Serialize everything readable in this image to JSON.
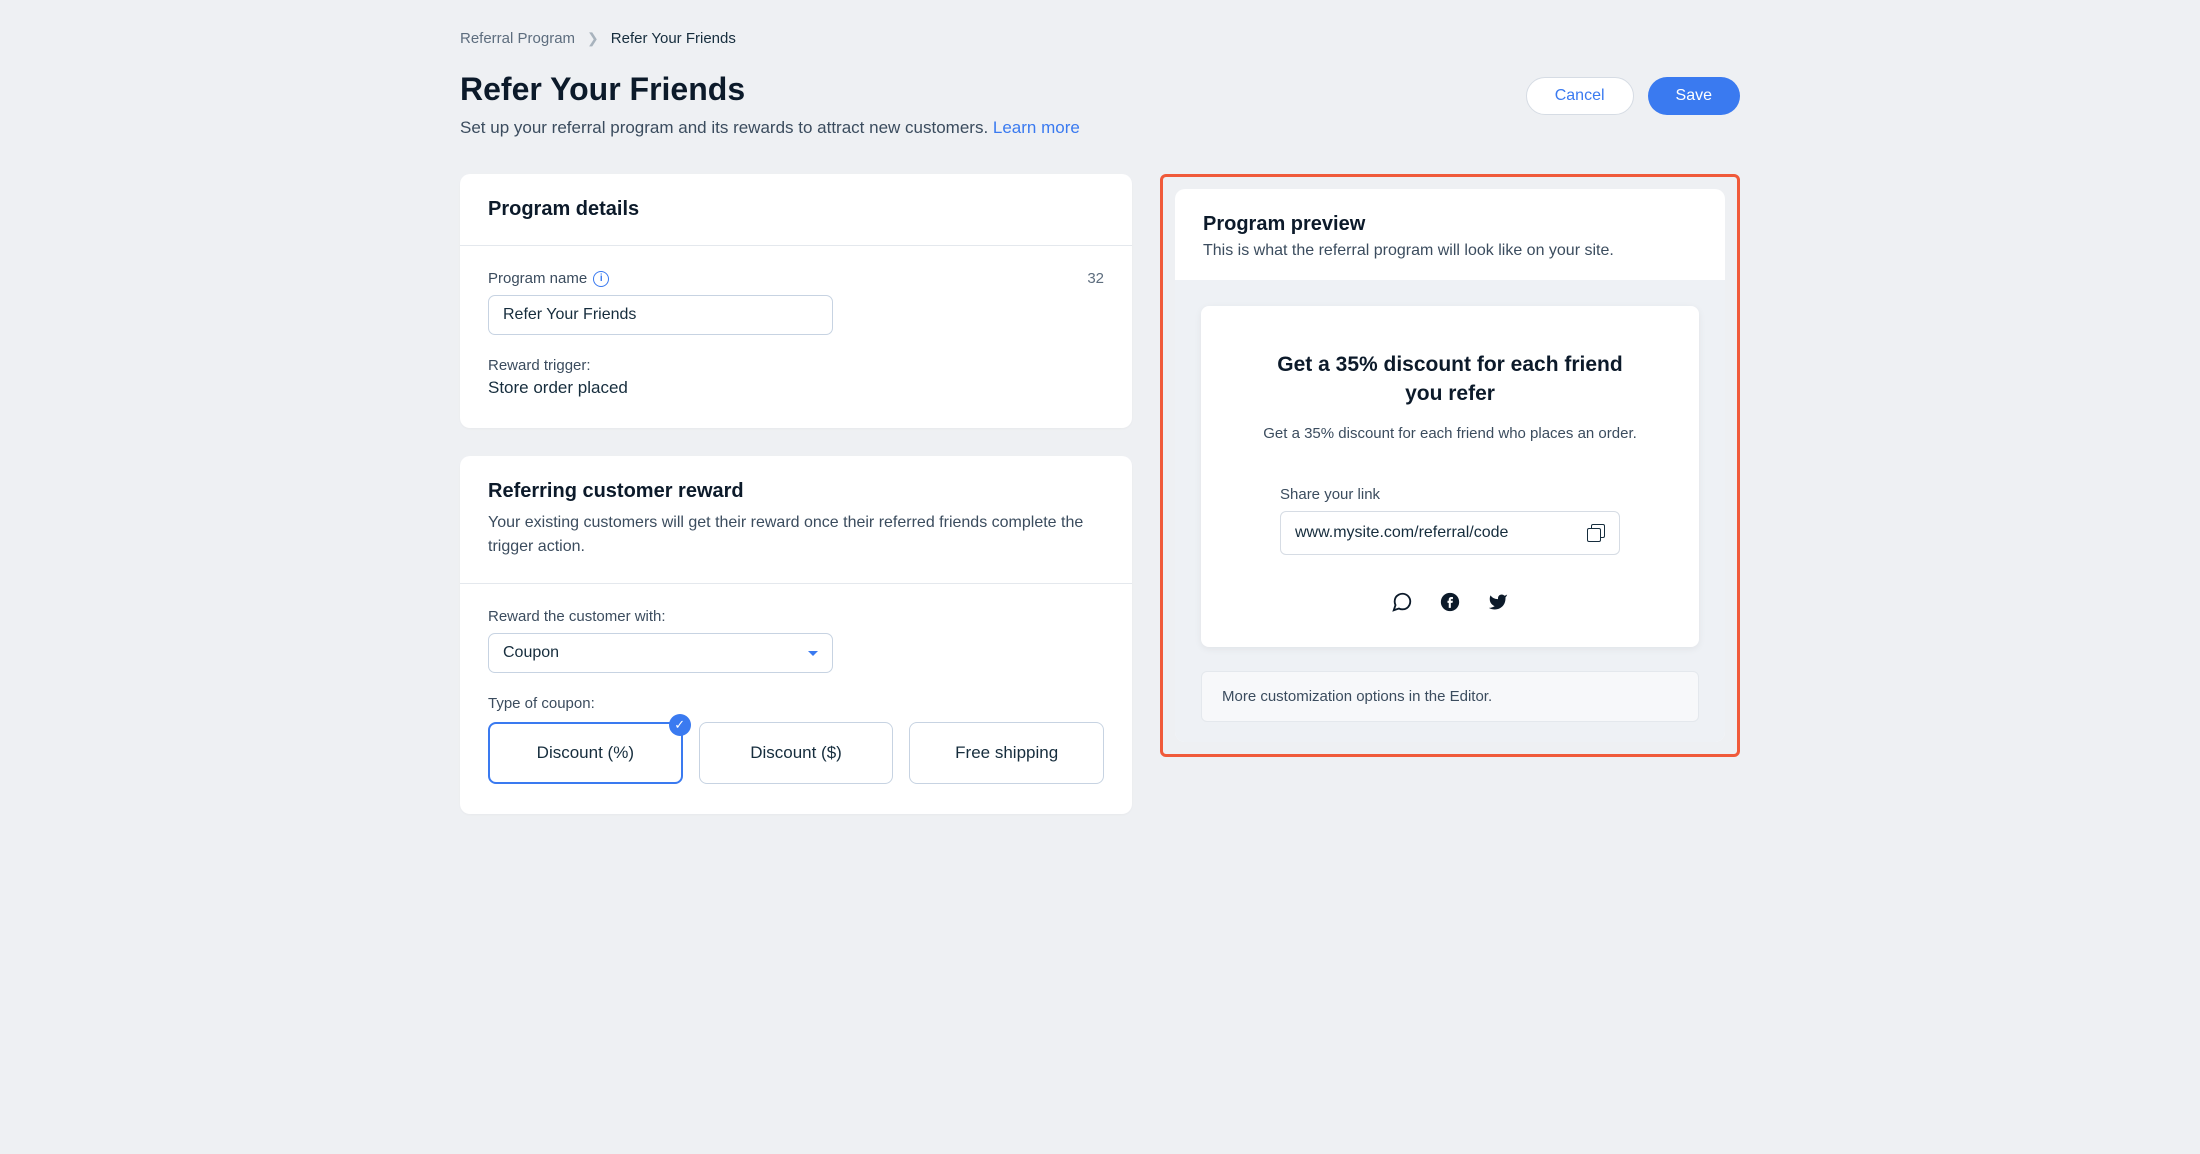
{
  "breadcrumb": {
    "parent": "Referral Program",
    "current": "Refer Your Friends"
  },
  "header": {
    "title": "Refer Your Friends",
    "subtitle": "Set up your referral program and its rewards to attract new customers. ",
    "learn_more": "Learn more"
  },
  "actions": {
    "cancel": "Cancel",
    "save": "Save"
  },
  "program_details": {
    "title": "Program details",
    "name_label": "Program name",
    "name_value": "Refer Your Friends",
    "char_count": "32",
    "trigger_label": "Reward trigger:",
    "trigger_value": "Store order placed"
  },
  "reward": {
    "title": "Referring customer reward",
    "subtitle": "Your existing customers will get their reward once their referred friends complete the trigger action.",
    "reward_with_label": "Reward the customer with:",
    "reward_with_value": "Coupon",
    "coupon_type_label": "Type of coupon:",
    "options": [
      "Discount (%)",
      "Discount ($)",
      "Free shipping"
    ]
  },
  "preview": {
    "title": "Program preview",
    "subtitle": "This is what the referral program will look like on your site.",
    "widget_headline": "Get a 35% discount for each friend you refer",
    "widget_sub": "Get a 35% discount for each friend who places an order.",
    "share_label": "Share your link",
    "share_url": "www.mysite.com/referral/code",
    "editor_note": "More customization options in the Editor."
  }
}
